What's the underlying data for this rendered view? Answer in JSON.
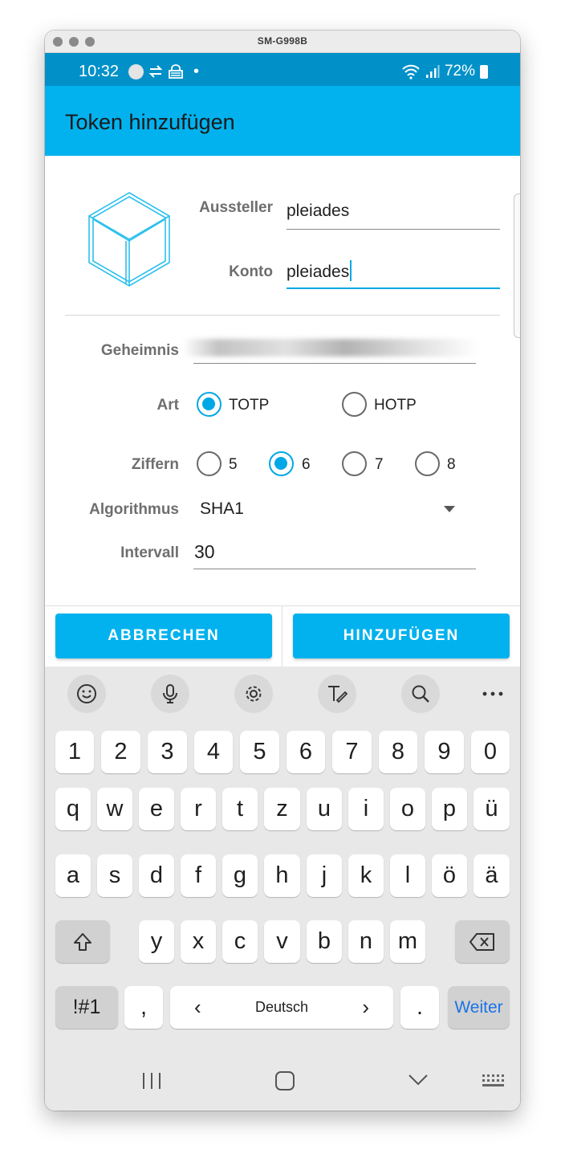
{
  "window": {
    "title": "SM-G998B"
  },
  "status_bar": {
    "time": "10:32",
    "dot": "•",
    "battery": "72%"
  },
  "app_bar": {
    "title": "Token hinzufügen"
  },
  "form": {
    "issuer_label": "Aussteller",
    "issuer_value": "pleiades",
    "account_label": "Konto",
    "account_value": "pleiades",
    "secret_label": "Geheimnis",
    "type_label": "Art",
    "type_options": [
      "TOTP",
      "HOTP"
    ],
    "type_selected": "TOTP",
    "digits_label": "Ziffern",
    "digits_options": [
      "5",
      "6",
      "7",
      "8"
    ],
    "digits_selected": "6",
    "algorithm_label": "Algorithmus",
    "algorithm_value": "SHA1",
    "interval_label": "Intervall",
    "interval_value": "30"
  },
  "actions": {
    "cancel": "ABBRECHEN",
    "add": "HINZUFÜGEN"
  },
  "keyboard": {
    "toolbar_icons": [
      "emoji-icon",
      "microphone-icon",
      "gear-icon",
      "handwriting-icon",
      "search-icon",
      "more-icon"
    ],
    "row_numbers": [
      "1",
      "2",
      "3",
      "4",
      "5",
      "6",
      "7",
      "8",
      "9",
      "0"
    ],
    "row1": [
      "q",
      "w",
      "e",
      "r",
      "t",
      "z",
      "u",
      "i",
      "o",
      "p",
      "ü"
    ],
    "row2": [
      "a",
      "s",
      "d",
      "f",
      "g",
      "h",
      "j",
      "k",
      "l",
      "ö",
      "ä"
    ],
    "row3": [
      "y",
      "x",
      "c",
      "v",
      "b",
      "n",
      "m"
    ],
    "symbols_key": "!#1",
    "comma_key": ",",
    "space_arrow_left": "‹",
    "space_label": "Deutsch",
    "space_arrow_right": "›",
    "period_key": ".",
    "enter_key": "Weiter",
    "enter_color": "#1a73e8"
  },
  "colors": {
    "accent": "#02b2ee",
    "status_bar": "#0191c8"
  }
}
